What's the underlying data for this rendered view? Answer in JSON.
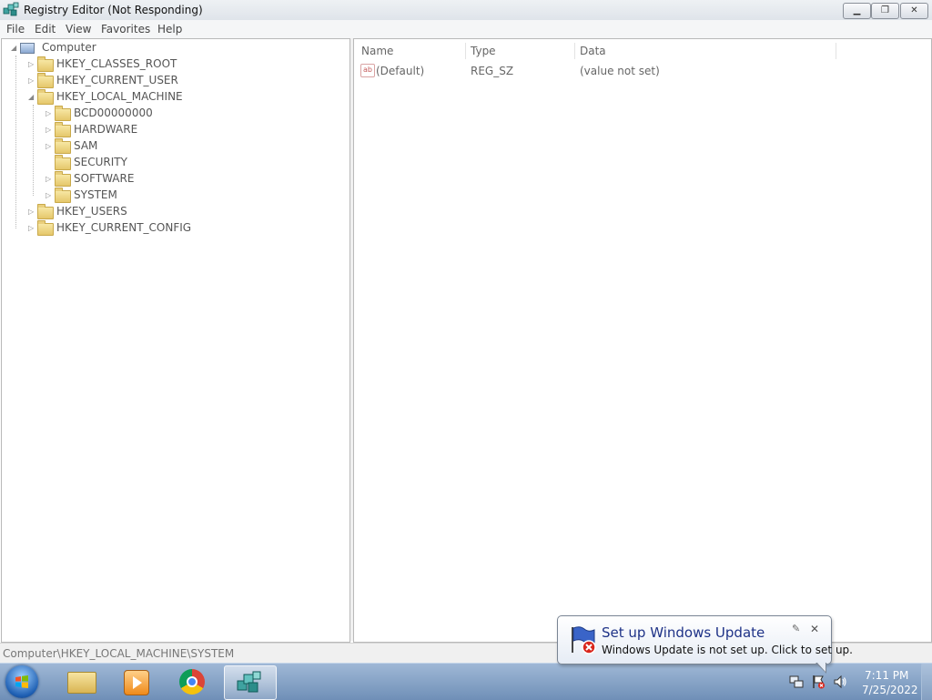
{
  "window": {
    "title": "Registry Editor (Not Responding)",
    "min_label": "▁",
    "max_label": "❐",
    "close_label": "✕"
  },
  "menu": [
    "File",
    "Edit",
    "View",
    "Favorites",
    "Help"
  ],
  "tree": {
    "root": "Computer",
    "items": [
      {
        "label": "HKEY_CLASSES_ROOT",
        "expander": "▷"
      },
      {
        "label": "HKEY_CURRENT_USER",
        "expander": "▷"
      },
      {
        "label": "HKEY_LOCAL_MACHINE",
        "expander": "◢"
      },
      {
        "label": "BCD00000000",
        "expander": "▷"
      },
      {
        "label": "HARDWARE",
        "expander": "▷"
      },
      {
        "label": "SAM",
        "expander": "▷"
      },
      {
        "label": "SECURITY",
        "expander": ""
      },
      {
        "label": "SOFTWARE",
        "expander": "▷"
      },
      {
        "label": "SYSTEM",
        "expander": "▷"
      },
      {
        "label": "HKEY_USERS",
        "expander": "▷"
      },
      {
        "label": "HKEY_CURRENT_CONFIG",
        "expander": "▷"
      }
    ],
    "root_expander": "◢"
  },
  "list": {
    "columns": [
      "Name",
      "Type",
      "Data"
    ],
    "rows": [
      {
        "icon": "ab",
        "name": "(Default)",
        "type": "REG_SZ",
        "data": "(value not set)"
      }
    ]
  },
  "status": {
    "path": "Computer\\HKEY_LOCAL_MACHINE\\SYSTEM"
  },
  "taskbar": {
    "pinned": [
      "windows-explorer-icon",
      "media-player-icon",
      "chrome-icon",
      "registry-editor-icon"
    ],
    "active": "registry-editor-icon"
  },
  "tray": {
    "time": "7:11 PM",
    "date": "7/25/2022"
  },
  "balloon": {
    "title": "Set up Windows Update",
    "text": "Windows Update is not set up. Click to set up.",
    "close_label": "✕",
    "pin_label": "✎"
  }
}
